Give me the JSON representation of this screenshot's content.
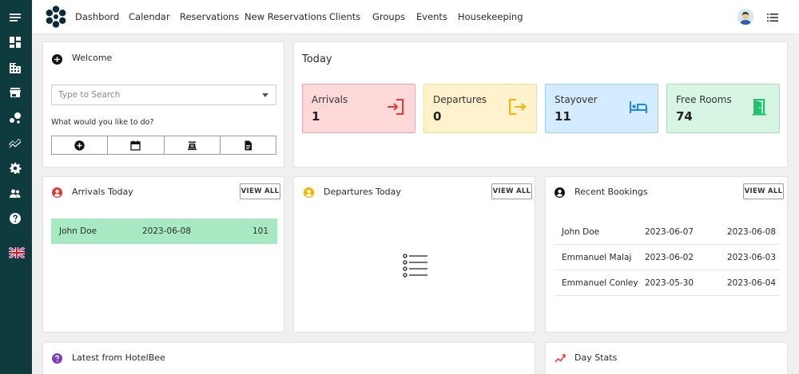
{
  "nav": {
    "items": [
      "Dashbord",
      "Calendar",
      "Reservations",
      "New Reservations",
      "Clients",
      "Groups",
      "Events",
      "Housekeeping"
    ]
  },
  "welcome": {
    "title": "Welcome",
    "search_placeholder": "Type to Search",
    "prompt": "What would you like to do?"
  },
  "today": {
    "title": "Today",
    "tiles": [
      {
        "label": "Arrivals",
        "value": "1",
        "icon": "login-icon",
        "color": "#e53935"
      },
      {
        "label": "Departures",
        "value": "0",
        "icon": "logout-icon",
        "color": "#f5b400"
      },
      {
        "label": "Stayover",
        "value": "11",
        "icon": "bed-icon",
        "color": "#1e88e5"
      },
      {
        "label": "Free Rooms",
        "value": "74",
        "icon": "door-open-icon",
        "color": "#1ec46b"
      }
    ]
  },
  "arrivals_today": {
    "title": "Arrivals Today",
    "view_all": "VIEW ALL",
    "rows": [
      {
        "name": "John Doe",
        "date": "2023-06-08",
        "room": "101"
      }
    ]
  },
  "departures_today": {
    "title": "Departures Today",
    "view_all": "VIEW ALL"
  },
  "recent_bookings": {
    "title": "Recent Bookings",
    "view_all": "VIEW ALL",
    "rows": [
      {
        "name": "John Doe",
        "from": "2023-06-07",
        "to": "2023-06-08"
      },
      {
        "name": "Emmanuel Malaj",
        "from": "2023-06-02",
        "to": "2023-06-03"
      },
      {
        "name": "Emmanuel Conley",
        "from": "2023-05-30",
        "to": "2023-06-04"
      }
    ]
  },
  "latest": {
    "title": "Latest from HotelBee"
  },
  "day_stats": {
    "title": "Day Stats"
  },
  "colors": {
    "sidebar": "#0d3b3e",
    "arrivals_row": "#a8e8c3",
    "arrivals_tile": "#ffd9da",
    "departures_tile": "#fff2cc",
    "stayover_tile": "#d4ecff",
    "free_rooms_tile": "#d6f5e2"
  }
}
